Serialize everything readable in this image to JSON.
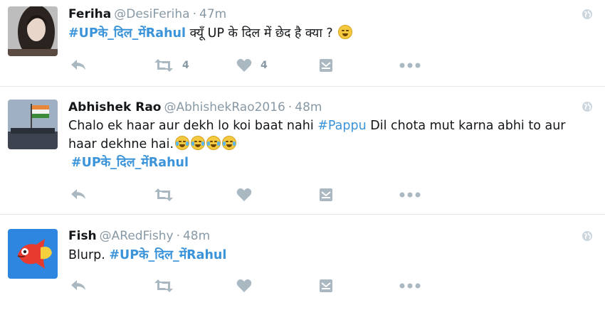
{
  "tweets": [
    {
      "name": "Feriha",
      "handle": "@DesiFeriha",
      "time": "47m",
      "hashtag": "#UPके_दिल_मेंRahul",
      "text": " क्यूँ UP के दिल में छेद है क्या ? ",
      "retweets": "4",
      "likes": "4"
    },
    {
      "name": "Abhishek Rao",
      "handle": "@AbhishekRao2016",
      "time": "48m",
      "text_a": "Chalo ek haar aur dekh lo koi baat nahi ",
      "link": "#Pappu",
      "text_b": " Dil chota mut karna abhi to aur haar dekhne hai.",
      "hashtag": "#UPके_दिल_मेंRahul"
    },
    {
      "name": "Fish",
      "handle": "@ARedFishy",
      "time": "48m",
      "text": "Blurp. ",
      "hashtag": "#UPके_दिल_मेंRahul"
    }
  ],
  "separator": "·",
  "icons": {
    "reply": "reply-icon",
    "retweet": "retweet-icon",
    "like": "heart-icon",
    "dm": "direct-message-icon",
    "more": "more-icon",
    "globe": "globe-icon",
    "grin": "grinning-face-emoji",
    "tears": "tears-of-joy-emoji"
  },
  "colors": {
    "link": "#3b94d9",
    "meta": "#8899a6",
    "action": "#aab8c2",
    "fish": "#2e86e0"
  }
}
